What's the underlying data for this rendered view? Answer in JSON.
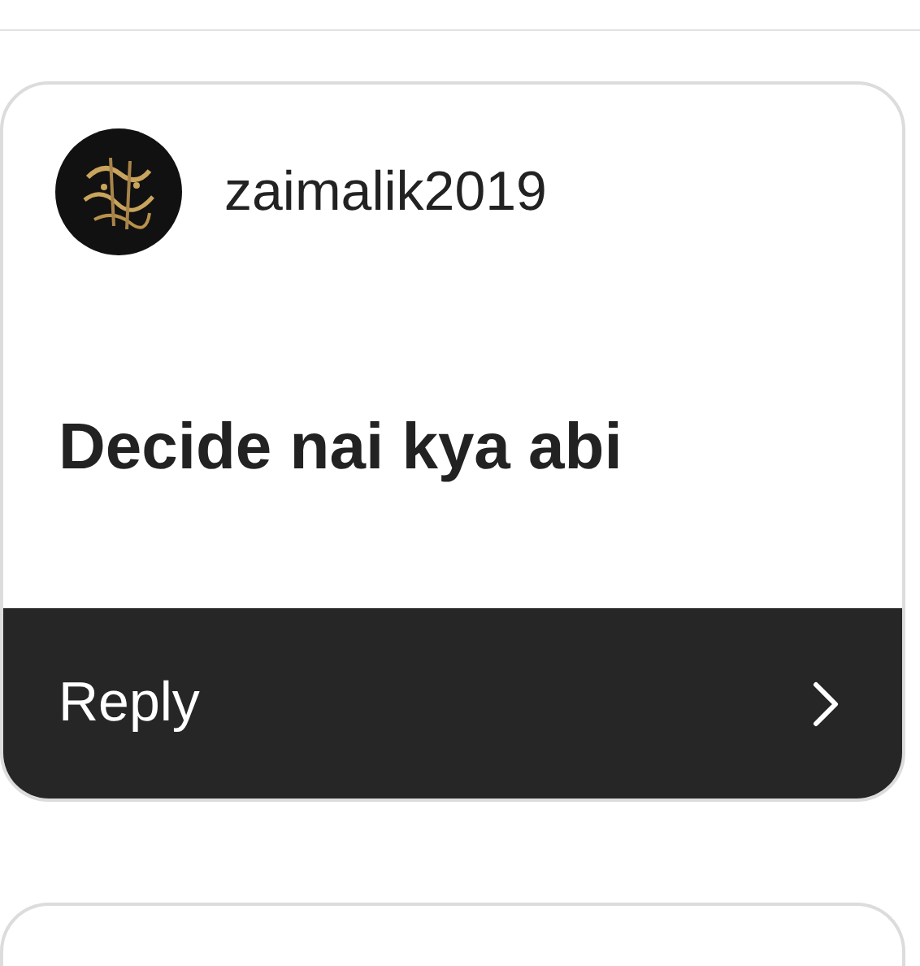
{
  "card": {
    "username": "zaimalik2019",
    "message": "Decide nai kya abi",
    "footer": {
      "label": "Reply"
    }
  }
}
